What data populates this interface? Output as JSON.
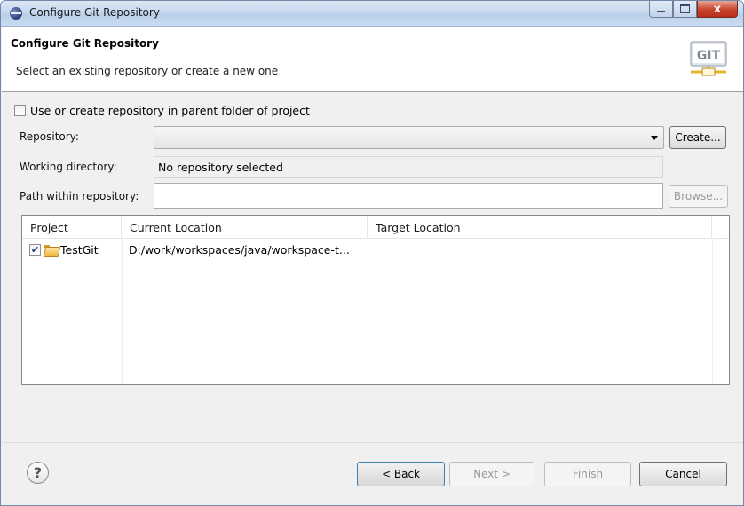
{
  "window": {
    "title": "Configure Git Repository",
    "controls": {
      "minimize": "",
      "maximize": "",
      "close": "x"
    }
  },
  "banner": {
    "title": "Configure Git Repository",
    "description": "Select an existing repository or create a new one",
    "logo_text": "GIT",
    "logo_icon": "git-logo-icon"
  },
  "form": {
    "use_parent_checkbox": {
      "label": "Use or create repository in parent folder of project",
      "checked": false
    },
    "repository_label": "Repository:",
    "repository_value": "",
    "create_button": "Create...",
    "working_dir_label": "Working directory:",
    "working_dir_value": "No repository selected",
    "path_label": "Path within repository:",
    "path_value": "",
    "browse_button": "Browse..."
  },
  "table": {
    "columns": [
      "Project",
      "Current Location",
      "Target Location"
    ],
    "rows": [
      {
        "checked": true,
        "project": "TestGit",
        "current_location": "D:/work/workspaces/java/workspace-t...",
        "target_location": ""
      }
    ]
  },
  "buttons": {
    "help_icon": "?",
    "back": "< Back",
    "next": "Next >",
    "finish": "Finish",
    "cancel": "Cancel"
  },
  "colors": {
    "titlebar": "#c7d9ee",
    "close_button": "#c7432b",
    "dialog_bg": "#f0f0f0",
    "git_logo": "#e7b52c"
  }
}
